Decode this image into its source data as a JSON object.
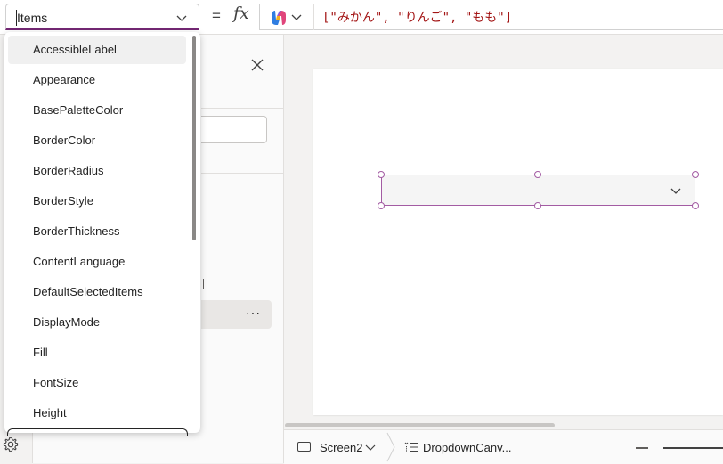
{
  "formula_bar": {
    "property_value": "Items",
    "equals": "=",
    "fx": "fx",
    "formula": "[\"みかん\", \"りんご\", \"もも\"]"
  },
  "property_list": {
    "items": [
      "AccessibleLabel",
      "Appearance",
      "BasePaletteColor",
      "BorderColor",
      "BorderRadius",
      "BorderStyle",
      "BorderThickness",
      "ContentLanguage",
      "DefaultSelectedItems",
      "DisplayMode",
      "Fill",
      "FontSize",
      "Height"
    ],
    "highlighted_index": 0
  },
  "status_bar": {
    "screen_name": "Screen2",
    "control_name": "DropdownCanv..."
  },
  "tree_pane": {
    "more_label": "···"
  },
  "colors": {
    "accent": "#742774",
    "selection_outline": "#a35ca3",
    "formula_string": "#a31515"
  }
}
